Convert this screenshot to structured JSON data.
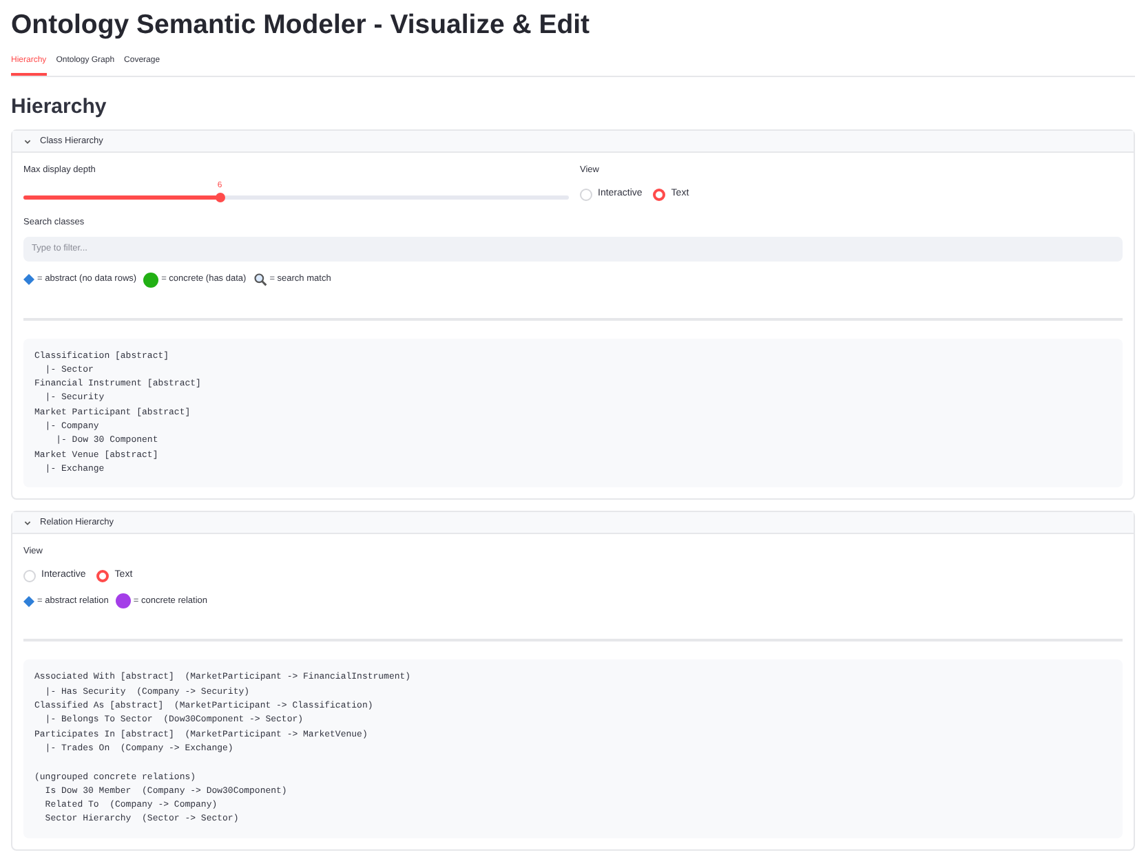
{
  "title": "Ontology Semantic Modeler - Visualize & Edit",
  "tabs": [
    {
      "label": "Hierarchy",
      "selected": true
    },
    {
      "label": "Ontology Graph",
      "selected": false
    },
    {
      "label": "Coverage",
      "selected": false
    }
  ],
  "heading": "Hierarchy",
  "sections": [
    {
      "title": "Class Hierarchy",
      "expanded": true,
      "slider": {
        "label": "Max display depth",
        "value": "6",
        "level": 0.36
      },
      "view": {
        "label": "View",
        "options": [
          {
            "label": "Interactive",
            "selected": false
          },
          {
            "label": "Text",
            "selected": true
          }
        ]
      },
      "search": {
        "label": "Search classes",
        "placeholder": "Type to filter..."
      },
      "legend": [
        {
          "kind": "diamond",
          "color": "#2f7fd8",
          "text": "= abstract (no data rows)"
        },
        {
          "kind": "circle",
          "color": "#22b014",
          "text": "= concrete (has data)"
        },
        {
          "kind": "magnifier",
          "text": "= search match"
        }
      ],
      "code": [
        [
          "Classification [abstract]",
          "  |- Sector",
          "Financial Instrument [abstract]",
          "  |- Security",
          "Market Participant [abstract]",
          "  |- Company",
          "    |- Dow 30 Component",
          "Market Venue [abstract]",
          "  |- Exchange"
        ]
      ]
    },
    {
      "title": "Relation Hierarchy",
      "expanded": true,
      "view": {
        "label": "View",
        "options": [
          {
            "label": "Interactive",
            "selected": false
          },
          {
            "label": "Text",
            "selected": true
          }
        ]
      },
      "legend": [
        {
          "kind": "diamond",
          "color": "#2f7fd8",
          "text": "= abstract relation"
        },
        {
          "kind": "circle",
          "color": "#a43ee8",
          "text": "= concrete relation"
        }
      ],
      "code": [
        [
          "Associated With [abstract]  (MarketParticipant -> FinancialInstrument)",
          "  |- Has Security  (Company -> Security)",
          "Classified As [abstract]  (MarketParticipant -> Classification)",
          "  |- Belongs To Sector  (Dow30Component -> Sector)",
          "Participates In [abstract]  (MarketParticipant -> MarketVenue)",
          "  |- Trades On  (Company -> Exchange)"
        ],
        [
          "(ungrouped concrete relations)",
          "  Is Dow 30 Member  (Company -> Dow30Component)",
          "  Related To  (Company -> Company)",
          "  Sector Hierarchy  (Sector -> Sector)"
        ]
      ]
    }
  ]
}
